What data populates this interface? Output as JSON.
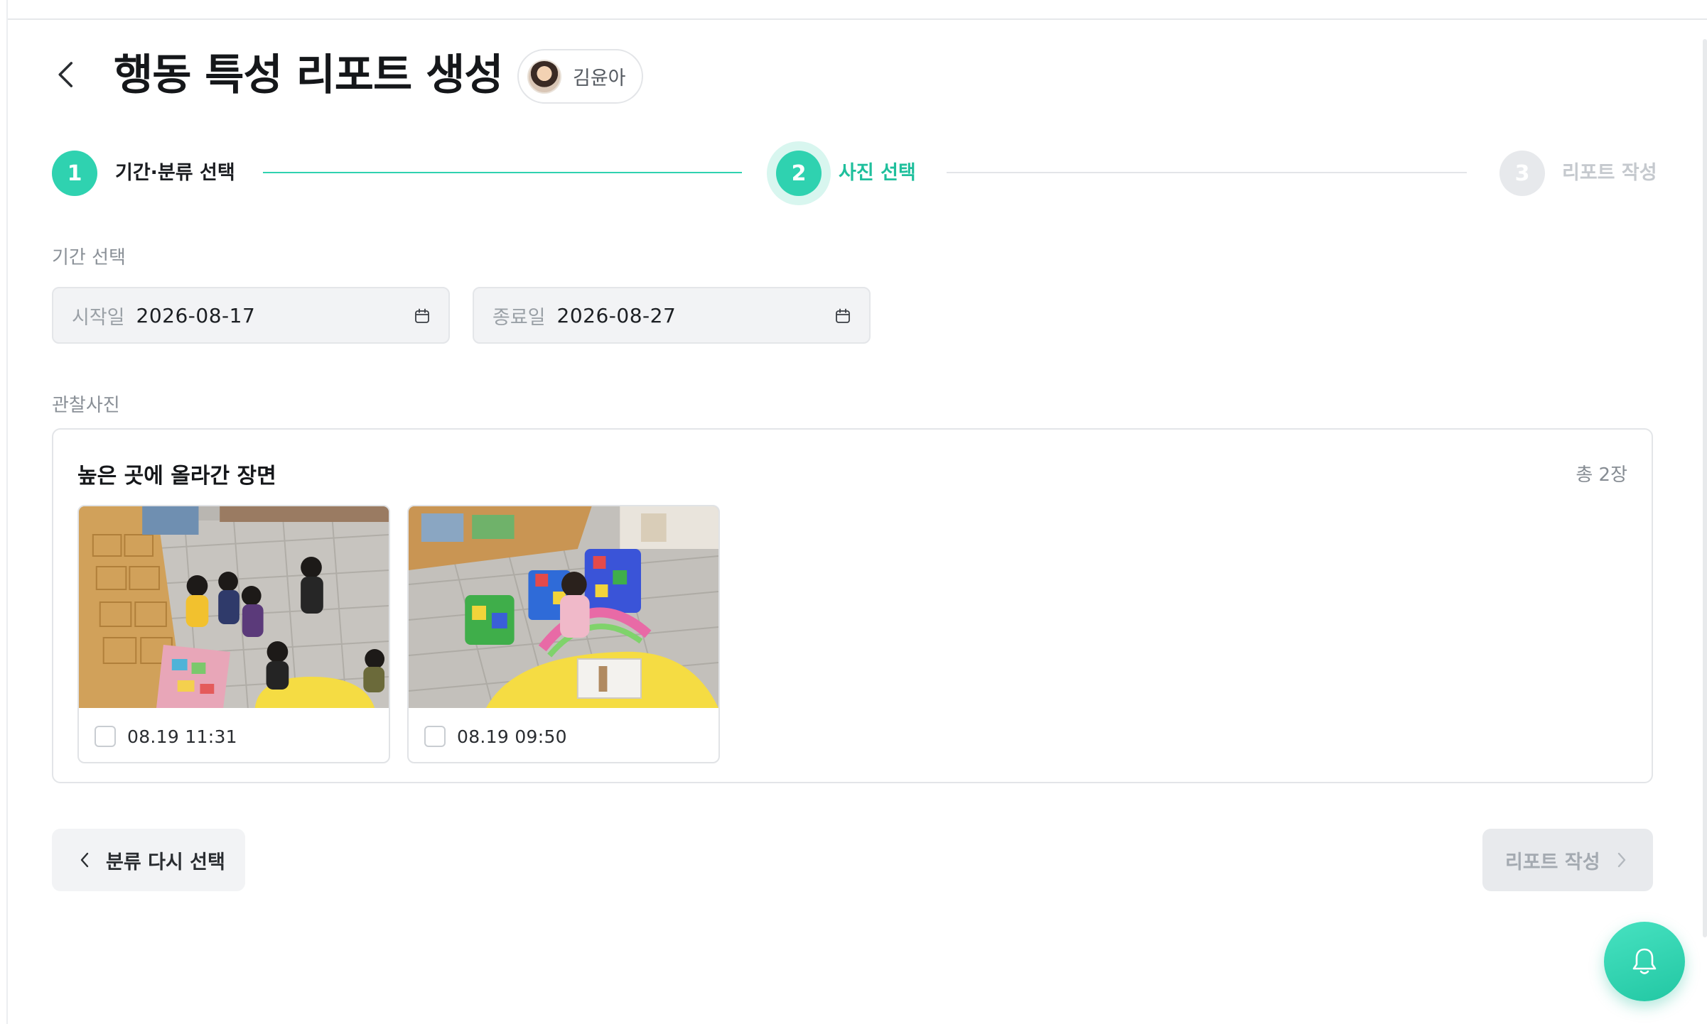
{
  "header": {
    "title": "행동 특성 리포트 생성",
    "child_name": "김윤아"
  },
  "stepper": {
    "steps": [
      {
        "number": "1",
        "label": "기간·분류 선택",
        "state": "done"
      },
      {
        "number": "2",
        "label": "사진 선택",
        "state": "active"
      },
      {
        "number": "3",
        "label": "리포트 작성",
        "state": "pending"
      }
    ]
  },
  "period": {
    "label": "기간 선택",
    "start_prefix": "시작일",
    "start_value": "2026-08-17",
    "end_prefix": "종료일",
    "end_value": "2026-08-27"
  },
  "photos": {
    "label": "관찰사진",
    "group_title": "높은 곳에 올라간 장면",
    "count": "총 2장",
    "items": [
      {
        "time": "08.19 11:31",
        "checked": false
      },
      {
        "time": "08.19 09:50",
        "checked": false
      }
    ]
  },
  "actions": {
    "back_label": "분류 다시 선택",
    "next_label": "리포트 작성"
  },
  "colors": {
    "accent": "#2fd2b0",
    "accent_text": "#1fbf9c",
    "disabled_bg": "#e8eaed",
    "field_bg": "#f2f3f5"
  },
  "icons": {
    "back": "chevron-left-icon",
    "calendar": "calendar-icon",
    "next": "chevron-right-icon",
    "notification": "bell-icon"
  }
}
